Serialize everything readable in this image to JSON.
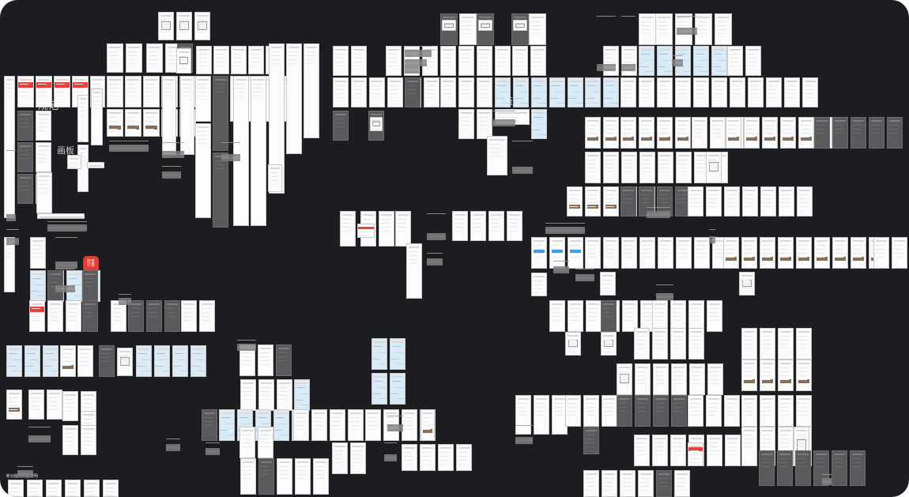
{
  "canvas": {
    "name": "design-board-overview",
    "background": "#1c1d20",
    "accent_red": "#e8403b",
    "map_blue": "#dbeaf4"
  },
  "labels": {
    "section_guidelines": "规范",
    "section_canvas": "画板",
    "section_page": "画板",
    "doc_heading": "新功能及交互说明"
  },
  "logo": {
    "lines": [
      "抖音",
      "订单"
    ]
  }
}
